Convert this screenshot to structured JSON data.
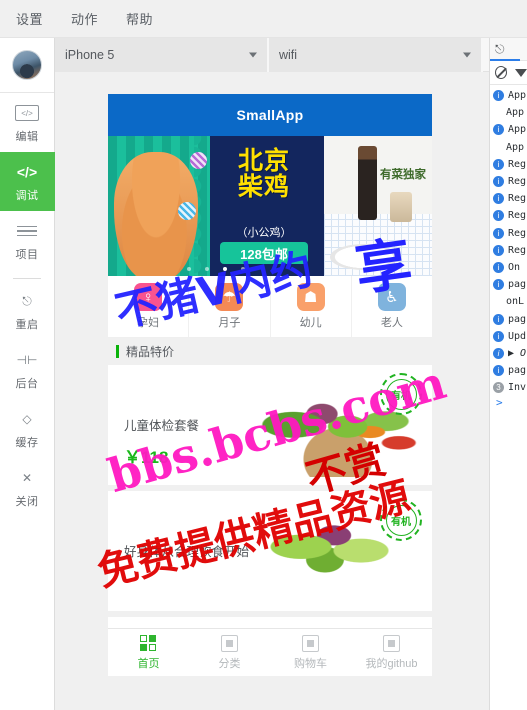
{
  "menubar": {
    "items": [
      {
        "label": "设置",
        "name": "menu-settings"
      },
      {
        "label": "动作",
        "name": "menu-actions"
      },
      {
        "label": "帮助",
        "name": "menu-help"
      }
    ]
  },
  "sidebar": {
    "avatar_name": "user-avatar",
    "items": [
      {
        "label": "编辑",
        "icon": "code-box-icon",
        "active": false
      },
      {
        "label": "调试",
        "icon": "code-icon",
        "active": true
      },
      {
        "label": "项目",
        "icon": "list-lines-icon",
        "active": false
      },
      {
        "label": "重启",
        "icon": "restart-icon",
        "active": false
      },
      {
        "label": "后台",
        "icon": "background-icon",
        "active": false
      },
      {
        "label": "缓存",
        "icon": "layers-icon",
        "active": false
      },
      {
        "label": "关闭",
        "icon": "close-x-icon",
        "active": false
      }
    ],
    "restart_glyph": "⎋",
    "background_glyph": "⊣⊢",
    "cache_glyph": "◇",
    "close_glyph": "✕"
  },
  "simulator_toolbar": {
    "device_select": {
      "value": "iPhone 5",
      "name": "device-select"
    },
    "network_select": {
      "value": "wifi",
      "name": "network-select"
    }
  },
  "phone": {
    "nav_title": "SmallApp",
    "banner_main": {
      "headline": "北京",
      "headline2": "柴鸡",
      "subtitle": "（小公鸡）",
      "price_badge": "128包邮"
    },
    "banner_side": {
      "caption": "有菜独家"
    },
    "categories": [
      {
        "label": "孕妇",
        "glyph": "♀",
        "color": "#f9538f"
      },
      {
        "label": "月子",
        "glyph": "☂",
        "color": "#f58a55"
      },
      {
        "label": "幼儿",
        "glyph": "☗",
        "color": "#f9a06a"
      },
      {
        "label": "老人",
        "glyph": "♿",
        "color": "#7fb3dd"
      }
    ],
    "section_title": "精品特价",
    "products": [
      {
        "name": "儿童体检套餐",
        "price": "￥118",
        "stamp": "有机"
      },
      {
        "name": "好身体从合理饮食开始",
        "price": "",
        "stamp": "有机"
      }
    ],
    "tabs": [
      {
        "label": "首页",
        "icon": "home-grid-icon",
        "active": true
      },
      {
        "label": "分类",
        "icon": "category-chip-icon",
        "active": false
      },
      {
        "label": "购物车",
        "icon": "cart-chip-icon",
        "active": false
      },
      {
        "label": "我的github",
        "icon": "profile-chip-icon",
        "active": false
      }
    ]
  },
  "console": {
    "toolbar": {
      "inspect_icon": "inspect-cursor-icon",
      "clear_icon": "clear-console-icon",
      "filter_icon": "filter-funnel-icon"
    },
    "entries": [
      {
        "badge": "i",
        "text": "App",
        "cont": false
      },
      {
        "badge": "",
        "text": "App",
        "cont": true
      },
      {
        "badge": "i",
        "text": "App",
        "cont": false
      },
      {
        "badge": "",
        "text": "App",
        "cont": true
      },
      {
        "badge": "i",
        "text": "Reg",
        "cont": false
      },
      {
        "badge": "i",
        "text": "Reg",
        "cont": false
      },
      {
        "badge": "i",
        "text": "Reg",
        "cont": false
      },
      {
        "badge": "i",
        "text": "Reg",
        "cont": false
      },
      {
        "badge": "i",
        "text": "Reg",
        "cont": false
      },
      {
        "badge": "i",
        "text": "Reg",
        "cont": false
      },
      {
        "badge": "i",
        "text": "On",
        "cont": false
      },
      {
        "badge": "i",
        "text": "pag",
        "cont": false
      },
      {
        "badge": "",
        "text": "onL",
        "cont": true
      },
      {
        "badge": "i",
        "text": "pag",
        "cont": false
      },
      {
        "badge": "i",
        "text": "Upd",
        "cont": false
      },
      {
        "badge": "i",
        "text": "▶ O",
        "cont": false,
        "italic": true
      },
      {
        "badge": "i",
        "text": "pag",
        "cont": false
      },
      {
        "badge": "3",
        "text": "Inv",
        "cont": false,
        "gray": true
      }
    ],
    "prompt": ">"
  },
  "watermarks": [
    {
      "text": "不猪V内约",
      "key": "w1"
    },
    {
      "text": "bbs.bcbs.com",
      "key": "w2"
    },
    {
      "text": "免费提供精品资源",
      "key": "w3"
    },
    {
      "text": "不赏",
      "key": "w4"
    },
    {
      "text": "享",
      "key": "w5"
    }
  ]
}
